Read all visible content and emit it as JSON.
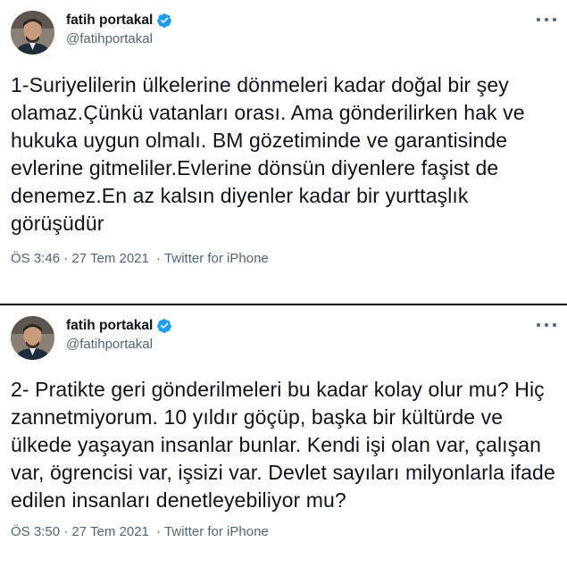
{
  "colors": {
    "background": "#ffffff",
    "text": "#0f1419",
    "secondary_text": "#536471",
    "verified_blue": "#1d9bf0",
    "separator": "#000000"
  },
  "tweets": [
    {
      "author": {
        "display_name": "fatih portakal",
        "handle": "@fatihportakal",
        "verified": true
      },
      "text": "1-Suriyelilerin ülkelerine dönmeleri kadar doğal bir şey olamaz.Çünkü vatanları orası. Ama gönderilirken hak ve hukuka uygun olmalı. BM gözetiminde ve garantisinde evlerine gitmeliler.Evlerine dönsün diyenlere faşist de denemez.En az kalsın diyenler kadar bir yurttaşlık görüşüdür",
      "time": "ÖS 3:46",
      "date": "27 Tem 2021",
      "separator": "·",
      "source": "Twitter for iPhone"
    },
    {
      "author": {
        "display_name": "fatih portakal",
        "handle": "@fatihportakal",
        "verified": true
      },
      "text": "2- Pratikte geri gönderilmeleri bu kadar kolay olur mu? Hiç zannetmiyorum. 10 yıldır göçüp, başka bir kültürde ve ülkede yaşayan insanlar bunlar. Kendi işi olan var, çalışan var, ögrencisi var, işsizi var. Devlet sayıları milyonlarla ifade edilen insanları denetleyebiliyor mu?",
      "time": "ÖS 3:50",
      "date": "27 Tem 2021",
      "separator": "·",
      "source": "Twitter for iPhone"
    }
  ]
}
